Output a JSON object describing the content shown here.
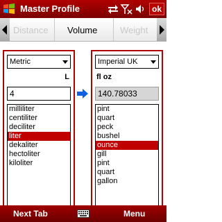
{
  "titlebar": {
    "title": "Master Profile",
    "ok_label": "ok",
    "start_icon": "windows-flag-icon",
    "status_icons": [
      "connectivity-icon",
      "signal-off-icon",
      "volume-icon"
    ],
    "accent_color": "#b00000"
  },
  "tabs": {
    "items": [
      "Distance",
      "Volume",
      "Weight"
    ],
    "selected": "Volume"
  },
  "left_panel": {
    "system": "Metric",
    "unit_label": "L",
    "value": "4",
    "units": [
      "milliliter",
      "centiliter",
      "deciliter",
      "liter",
      "dekaliter",
      "hectoliter",
      "kiloliter"
    ],
    "selected_unit": "liter"
  },
  "right_panel": {
    "system": "Imperial UK",
    "unit_label": "fl oz",
    "value": "140.78033",
    "units": [
      "pint",
      "quart",
      "peck",
      "bushel",
      "ounce",
      "gill",
      "pint",
      "quart",
      "gallon"
    ],
    "selected_unit": "ounce"
  },
  "convert_arrow_icon": "arrow-right-icon",
  "bottombar": {
    "left_softkey": "Next Tab",
    "right_softkey": "Menu",
    "center_icon": "keyboard-icon"
  }
}
